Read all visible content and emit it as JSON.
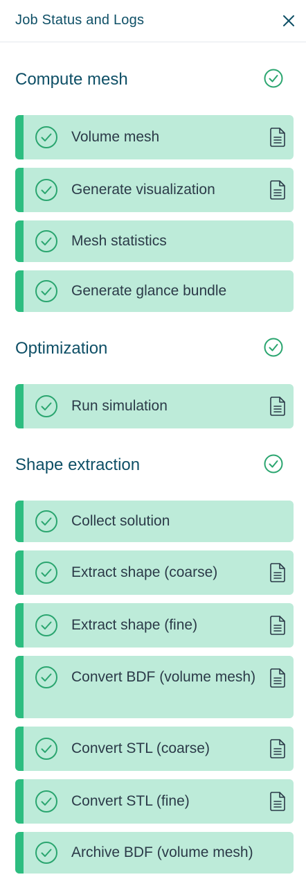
{
  "header": {
    "title": "Job Status and Logs",
    "close_icon": "close-icon"
  },
  "colors": {
    "title": "#0e4f66",
    "accent": "#2dbd80",
    "task_bg": "#bdebd9",
    "check": "#2aa56f"
  },
  "sections": [
    {
      "title": "Compute mesh",
      "status": "complete",
      "tasks": [
        {
          "label": "Volume mesh",
          "status": "complete",
          "has_log": true
        },
        {
          "label": "Generate visualization",
          "status": "complete",
          "has_log": true
        },
        {
          "label": "Mesh statistics",
          "status": "complete",
          "has_log": false
        },
        {
          "label": "Generate glance bundle",
          "status": "complete",
          "has_log": false
        }
      ]
    },
    {
      "title": "Optimization",
      "status": "complete",
      "tasks": [
        {
          "label": "Run simulation",
          "status": "complete",
          "has_log": true
        }
      ]
    },
    {
      "title": "Shape extraction",
      "status": "complete",
      "tasks": [
        {
          "label": "Collect solution",
          "status": "complete",
          "has_log": false
        },
        {
          "label": "Extract shape (coarse)",
          "status": "complete",
          "has_log": true
        },
        {
          "label": "Extract shape (fine)",
          "status": "complete",
          "has_log": true
        },
        {
          "label": "Convert BDF (volume mesh)",
          "status": "complete",
          "has_log": true
        },
        {
          "label": "Convert STL (coarse)",
          "status": "complete",
          "has_log": true
        },
        {
          "label": "Convert STL (fine)",
          "status": "complete",
          "has_log": true
        },
        {
          "label": "Archive BDF (volume mesh)",
          "status": "complete",
          "has_log": false
        }
      ]
    }
  ]
}
